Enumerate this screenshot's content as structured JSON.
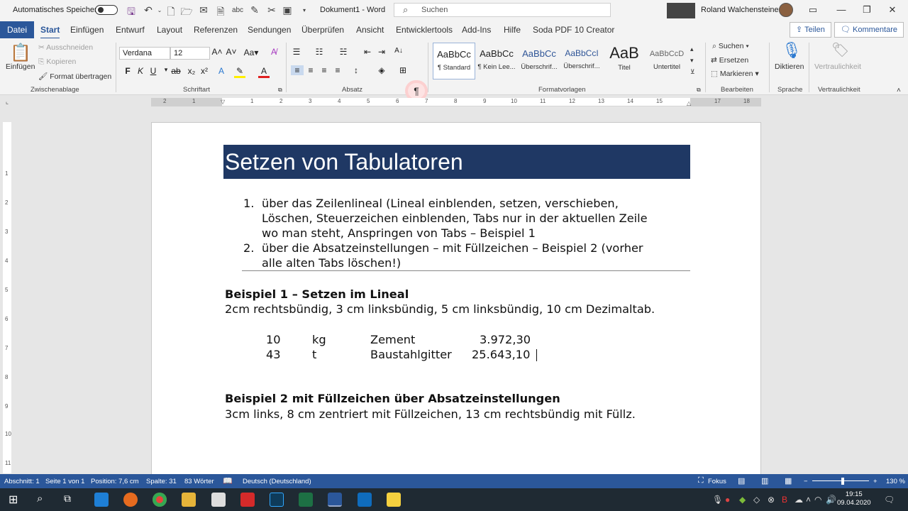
{
  "titlebar": {
    "autosave_label": "Automatisches Speichern",
    "document_title": "Dokument1 - Word",
    "search_placeholder": "Suchen",
    "user_name": "Roland Walchensteiner"
  },
  "menu": {
    "tabs": [
      "Datei",
      "Start",
      "Einfügen",
      "Entwurf",
      "Layout",
      "Referenzen",
      "Sendungen",
      "Überprüfen",
      "Ansicht",
      "Entwicklertools",
      "Add-Ins",
      "Hilfe",
      "Soda PDF 10 Creator"
    ],
    "active_tab": "Start",
    "share_label": "Teilen",
    "comments_label": "Kommentare"
  },
  "ribbon": {
    "clipboard": {
      "paste_label": "Einfügen",
      "cut_label": "Ausschneiden",
      "copy_label": "Kopieren",
      "format_painter_label": "Format übertragen",
      "group_label": "Zwischenablage"
    },
    "font": {
      "font_name": "Verdana",
      "font_size": "12",
      "bold": "F",
      "italic": "K",
      "underline": "U",
      "group_label": "Schriftart"
    },
    "paragraph": {
      "group_label": "Absatz"
    },
    "styles": {
      "items": [
        {
          "preview": "AaBbCc",
          "name": "¶ Standard"
        },
        {
          "preview": "AaBbCc",
          "name": "¶ Kein Lee..."
        },
        {
          "preview": "AaBbCc",
          "name": "Überschrif..."
        },
        {
          "preview": "AaBbCcI",
          "name": "Überschrif..."
        },
        {
          "preview": "AaB",
          "name": "Titel"
        },
        {
          "preview": "AaBbCcD",
          "name": "Untertitel"
        }
      ],
      "group_label": "Formatvorlagen"
    },
    "editing": {
      "find_label": "Suchen",
      "replace_label": "Ersetzen",
      "select_label": "Markieren",
      "group_label": "Bearbeiten"
    },
    "voice": {
      "dictate_label": "Diktieren",
      "group_label": "Sprache"
    },
    "sensitivity": {
      "label": "Vertraulichkeit",
      "group_label": "Vertraulichkeit"
    }
  },
  "ruler": {
    "h_numbers": [
      "2",
      "1",
      "1",
      "2",
      "3",
      "4",
      "5",
      "6",
      "7",
      "8",
      "9",
      "10",
      "11",
      "12",
      "13",
      "14",
      "15",
      "17",
      "18"
    ],
    "v_numbers": [
      "1",
      "2",
      "3",
      "4",
      "5",
      "6",
      "7",
      "8",
      "9",
      "10",
      "11"
    ]
  },
  "document": {
    "heading": "Setzen von Tabulatoren",
    "list": [
      {
        "num": "1.",
        "lines": [
          "über das Zeilenlineal (Lineal einblenden, setzen, verschieben,",
          "Löschen, Steuerzeichen einblenden, Tabs nur in der aktuellen Zeile",
          "wo man steht, Anspringen von Tabs – Beispiel 1"
        ]
      },
      {
        "num": "2.",
        "lines": [
          "über die Absatzeinstellungen – mit Füllzeichen – Beispiel 2 (vorher",
          "alle alten Tabs löschen!)"
        ]
      }
    ],
    "example1_title": "Beispiel 1 – Setzen im Lineal",
    "example1_desc": "2cm rechtsbündig, 3 cm linksbündig, 5 cm linksbündig, 10 cm Dezimaltab.",
    "table_rows": [
      {
        "qty": "10",
        "unit": "kg",
        "item": "Zement",
        "price": "3.972,30"
      },
      {
        "qty": "43",
        "unit": "t",
        "item": "Baustahlgitter",
        "price": "25.643,10"
      }
    ],
    "example2_title": "Beispiel 2 mit Füllzeichen über Absatzeinstellungen",
    "example2_desc": "3cm links, 8 cm zentriert mit Füllzeichen, 13 cm rechtsbündig mit Füllz."
  },
  "statusbar": {
    "section": "Abschnitt: 1",
    "page": "Seite 1 von 1",
    "position": "Position: 7,6 cm",
    "column": "Spalte: 31",
    "words": "83 Wörter",
    "language": "Deutsch (Deutschland)",
    "focus": "Fokus",
    "zoom": "130 %"
  },
  "taskbar": {
    "time": "19:15",
    "date": "09.04.2020"
  },
  "colors": {
    "word_blue": "#2b579a",
    "heading_bg": "#1f3864",
    "taskbar": "#1f2a33"
  }
}
